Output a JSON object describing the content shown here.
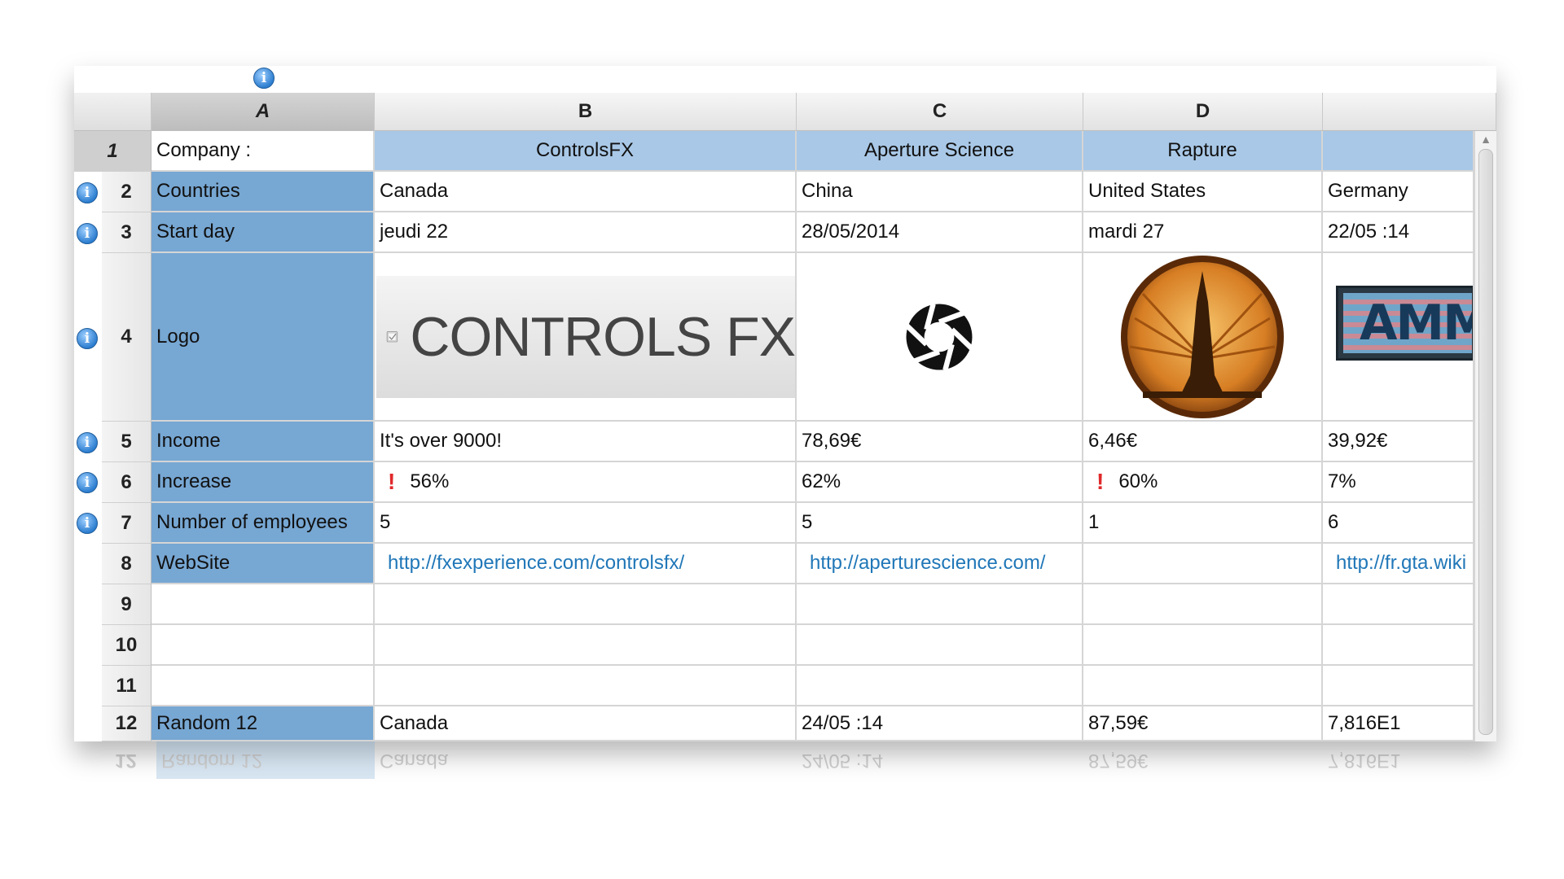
{
  "columns": {
    "A": "A",
    "B": "B",
    "C": "C",
    "D": "D"
  },
  "rows": {
    "r1": "1",
    "r2": "2",
    "r3": "3",
    "r4": "4",
    "r5": "5",
    "r6": "6",
    "r7": "7",
    "r8": "8",
    "r9": "9",
    "r10": "10",
    "r11": "11",
    "r12": "12"
  },
  "cells": {
    "a1": "Company :",
    "b1": "ControlsFX",
    "c1": "Aperture Science",
    "d1": "Rapture",
    "e1": "",
    "a2": "Countries",
    "b2": "Canada",
    "c2": "China",
    "d2": "United States",
    "e2": "Germany",
    "a3": "Start day",
    "b3": "jeudi 22",
    "c3": "28/05/2014",
    "d3": "mardi 27",
    "e3": "22/05 :14",
    "a4": "Logo",
    "b4_logo_text": "CONTROLS FX",
    "e4_logo_text": "AMM",
    "a5": "Income",
    "b5": "It's over 9000!",
    "c5": "78,69€",
    "d5": "6,46€",
    "e5": "39,92€",
    "a6": "Increase",
    "b6": "56%",
    "c6": "62%",
    "d6": "60%",
    "e6": "7%",
    "a7": "Number of employees",
    "b7": "5",
    "c7": "5",
    "d7": "1",
    "e7": "6",
    "a8": "WebSite",
    "b8": "http://fxexperience.com/controlsfx/",
    "c8": "http://aperturescience.com/",
    "d8": "",
    "e8": "http://fr.gta.wiki",
    "a12": "Random 12",
    "b12": "Canada",
    "c12": "24/05 :14",
    "d12": "87,59€",
    "e12": "7,816E1"
  },
  "icons": {
    "info": "info-icon",
    "warning": "exclamation-icon",
    "excl_glyph": "!",
    "info_glyph": "i"
  },
  "colors": {
    "header_cell_blue": "#77a7d3",
    "header_row_light_blue": "#a9c8e7",
    "link": "#2077b8",
    "warning": "#e0292b"
  }
}
